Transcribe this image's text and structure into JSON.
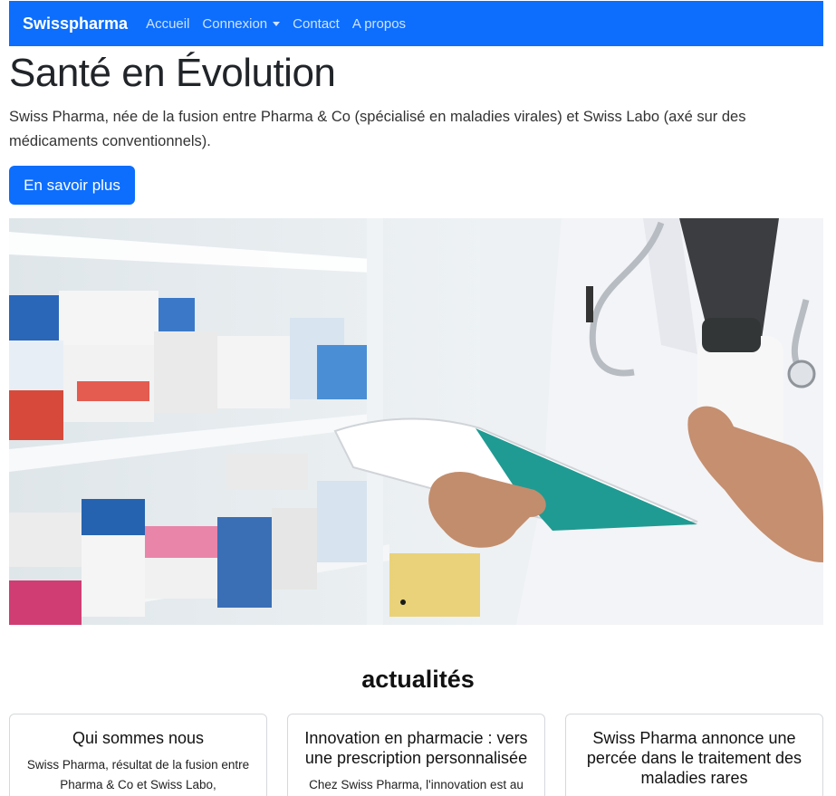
{
  "navbar": {
    "brand": "Swisspharma",
    "links": [
      "Accueil",
      "Connexion",
      "Contact",
      "A propos"
    ]
  },
  "hero": {
    "title": "Santé en Évolution",
    "text": "Swiss Pharma, née de la fusion entre Pharma & Co (spécialisé en maladies virales) et Swiss Labo (axé sur des médicaments conventionnels).",
    "button": "En savoir plus"
  },
  "carousel": {
    "image_label": "pharmacist-holding-clipboard-and-medicine-bottle",
    "indicator_count": 1
  },
  "news": {
    "title": "actualités",
    "cards": [
      {
        "title": "Qui sommes nous",
        "text": "Swiss Pharma, résultat de la fusion entre Pharma & Co et Swiss Labo,"
      },
      {
        "title": "Innovation en pharmacie : vers une prescription personnalisée",
        "text": "Chez Swiss Pharma, l'innovation est au"
      },
      {
        "title": "Swiss Pharma annonce une percée dans le traitement des maladies rares",
        "text": ""
      }
    ]
  },
  "colors": {
    "primary": "#0d6efd"
  }
}
